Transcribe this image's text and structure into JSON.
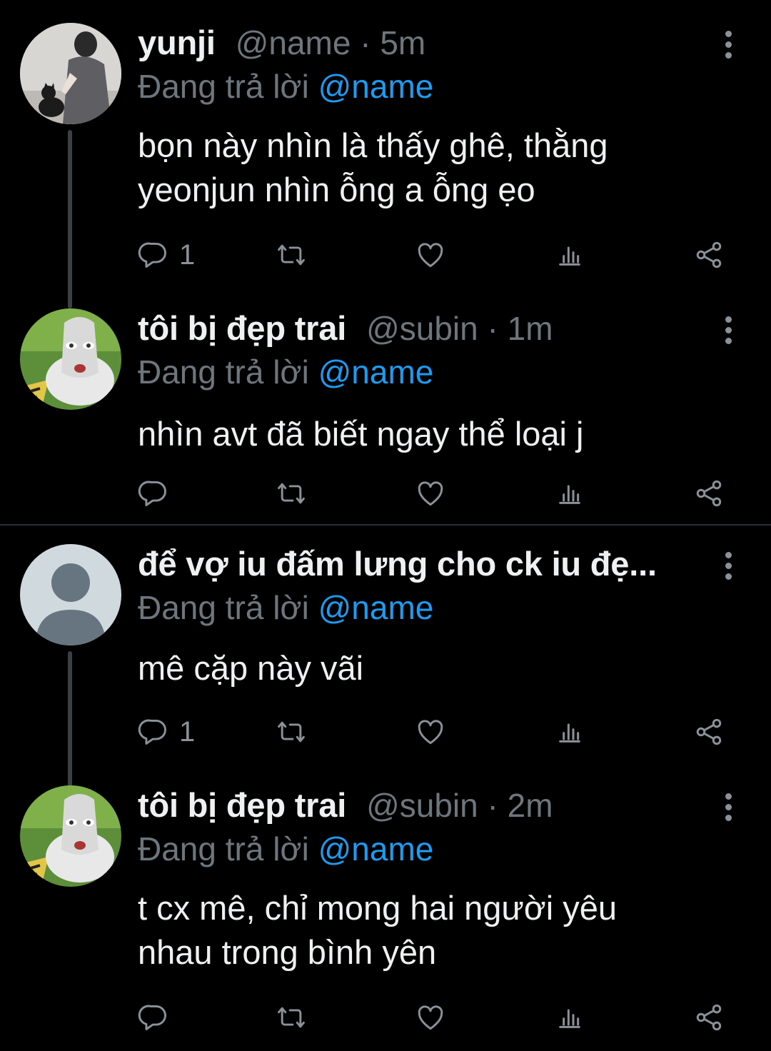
{
  "replies": [
    {
      "name": "yunji",
      "handle": "@name · 5m",
      "replying_prefix": "Đang trả lời ",
      "replying_to": "@name",
      "text_lines": [
        "bọn này nhìn là thấy ghê, thằng",
        "yeonjun nhìn ỗng a ỗng ẹo"
      ],
      "reply_count": "1",
      "avatar": "photo-girl-with-cat"
    },
    {
      "name": "tôi bị đẹp trai",
      "handle": "@subin · 1m",
      "replying_prefix": "Đang trả lời ",
      "replying_to": "@name",
      "text_lines": [
        "nhìn avt đã biết ngay thể loại j"
      ],
      "reply_count": "",
      "avatar": "cartoon-face"
    },
    {
      "name": "để vợ iu đấm lưng cho ck iu đẹ...",
      "handle": "",
      "replying_prefix": "Đang trả lời ",
      "replying_to": "@name",
      "text_lines": [
        "mê cặp này vãi"
      ],
      "reply_count": "1",
      "avatar": "default-profile"
    },
    {
      "name": "tôi bị đẹp trai",
      "handle": "@subin · 2m",
      "replying_prefix": "Đang trả lời ",
      "replying_to": "@name",
      "text_lines": [
        "t cx mê, chỉ mong hai người yêu",
        "nhau trong bình yên"
      ],
      "reply_count": "",
      "avatar": "cartoon-face"
    }
  ],
  "icons": [
    "reply-icon",
    "retweet-icon",
    "like-icon",
    "analytics-icon",
    "share-icon",
    "more-icon"
  ],
  "colors": {
    "background": "#000000",
    "mention": "#1d9bf0",
    "muted": "#6e767d",
    "text": "#eef0f1"
  }
}
